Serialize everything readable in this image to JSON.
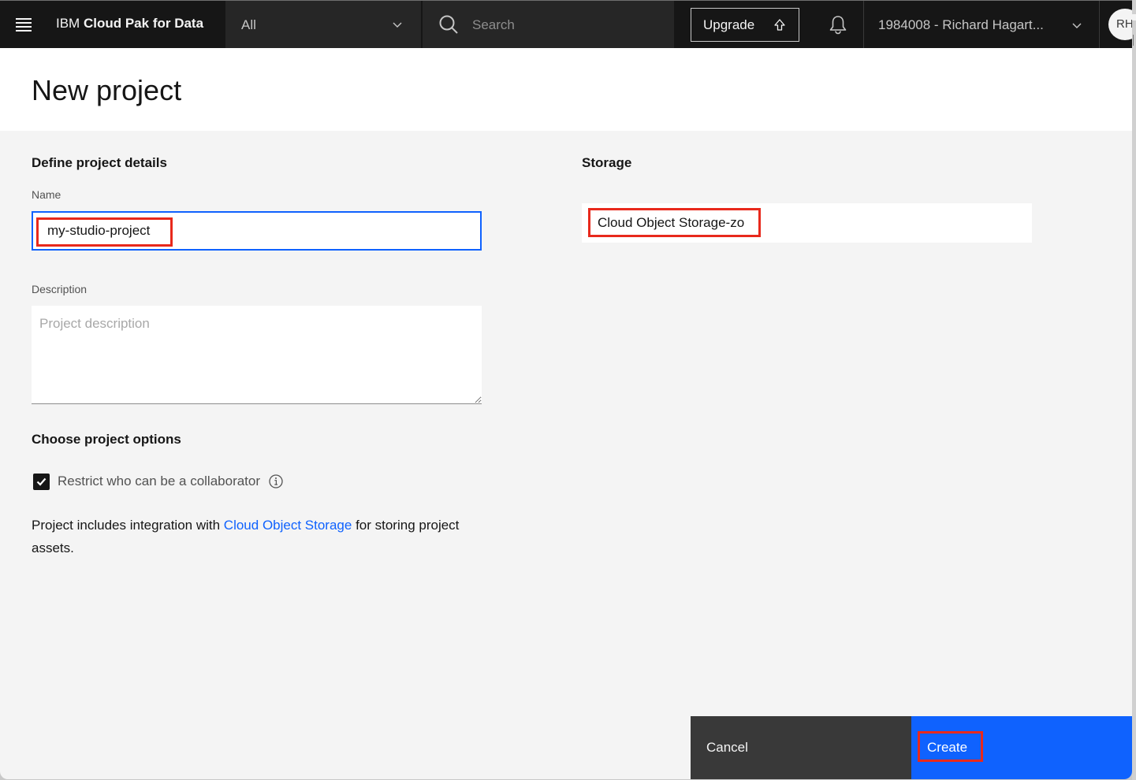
{
  "header": {
    "brand_prefix": "IBM",
    "brand_name": "Cloud Pak for Data",
    "scope_value": "All",
    "search_placeholder": "Search",
    "upgrade_label": "Upgrade",
    "account_label": "1984008 - Richard Hagart...",
    "avatar_initials": "RH"
  },
  "page": {
    "title": "New project"
  },
  "details": {
    "heading": "Define project details",
    "name_label": "Name",
    "name_value": "my-studio-project",
    "description_label": "Description",
    "description_placeholder": "Project description",
    "description_value": ""
  },
  "options": {
    "heading": "Choose project options",
    "restrict_label": "Restrict who can be a collaborator",
    "restrict_checked": true,
    "integration_text_before": "Project includes integration with ",
    "integration_link": "Cloud Object Storage",
    "integration_text_after": " for storing project assets."
  },
  "storage": {
    "heading": "Storage",
    "value": "Cloud Object Storage-zo"
  },
  "footer": {
    "cancel_label": "Cancel",
    "create_label": "Create"
  },
  "colors": {
    "primary": "#0f62fe",
    "header_bg": "#161616",
    "highlight": "#e8291c"
  }
}
